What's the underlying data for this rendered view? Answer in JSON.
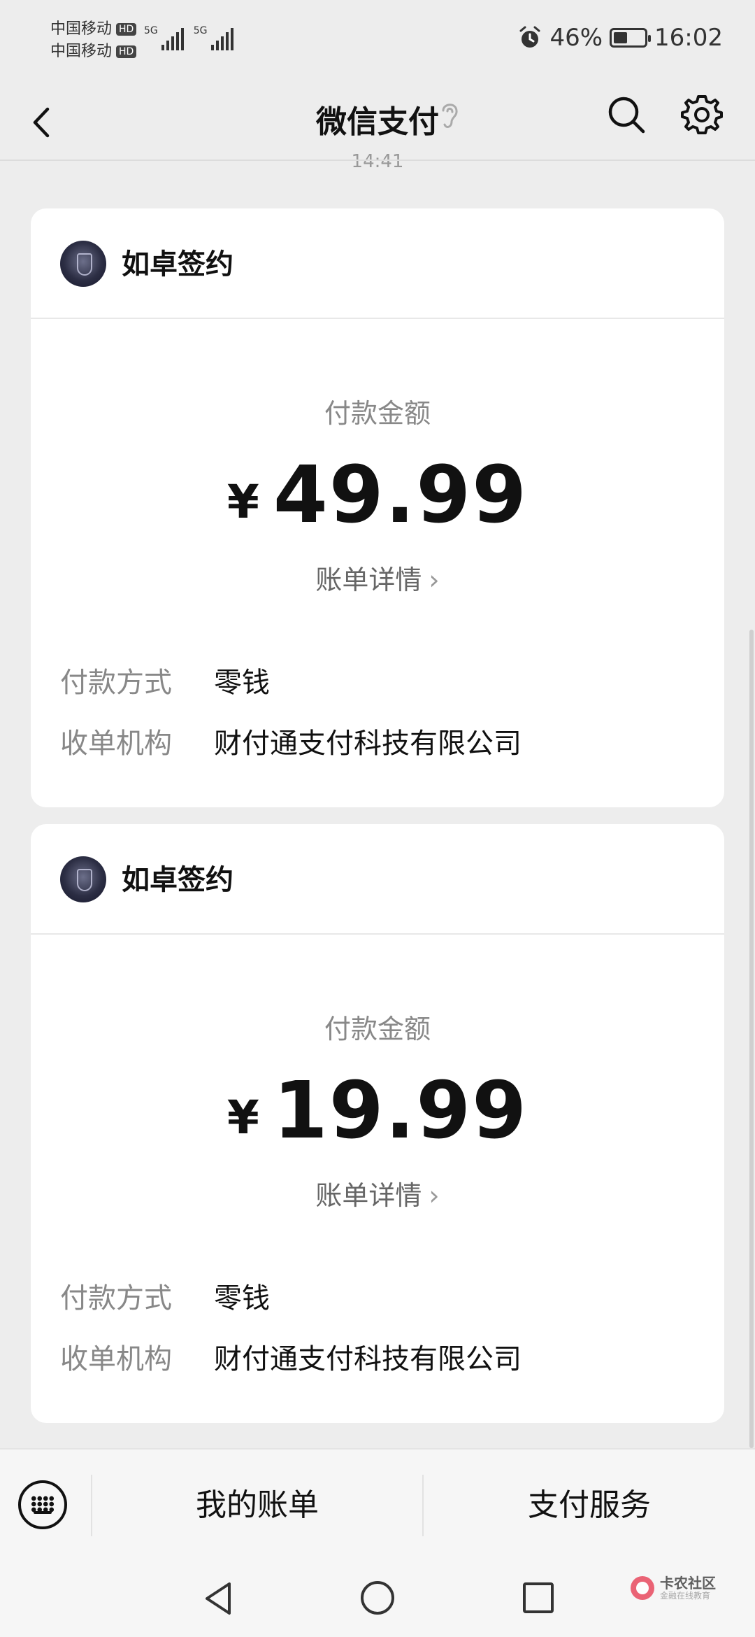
{
  "status_bar": {
    "carrier_1": "中国移动",
    "carrier_2": "中国移动",
    "hd_badge": "HD",
    "network_1": "5G",
    "network_2": "5G",
    "battery": "46%",
    "battery_level": 0.46,
    "time": "16:02"
  },
  "header": {
    "title": "微信支付"
  },
  "timestamp_partial": "14:41",
  "payments": [
    {
      "merchant": "如卓签约",
      "amount_label": "付款金额",
      "currency": "¥",
      "amount": "49.99",
      "bill_detail": "账单详情",
      "rows": [
        {
          "key": "付款方式",
          "value": "零钱"
        },
        {
          "key": "收单机构",
          "value": "财付通支付科技有限公司"
        }
      ]
    },
    {
      "merchant": "如卓签约",
      "amount_label": "付款金额",
      "currency": "¥",
      "amount": "19.99",
      "bill_detail": "账单详情",
      "rows": [
        {
          "key": "付款方式",
          "value": "零钱"
        },
        {
          "key": "收单机构",
          "value": "财付通支付科技有限公司"
        }
      ]
    }
  ],
  "bottom_bar": {
    "my_bills": "我的账单",
    "pay_services": "支付服务"
  },
  "watermark": {
    "title": "卡农社区",
    "subtitle": "金融在线教育"
  }
}
